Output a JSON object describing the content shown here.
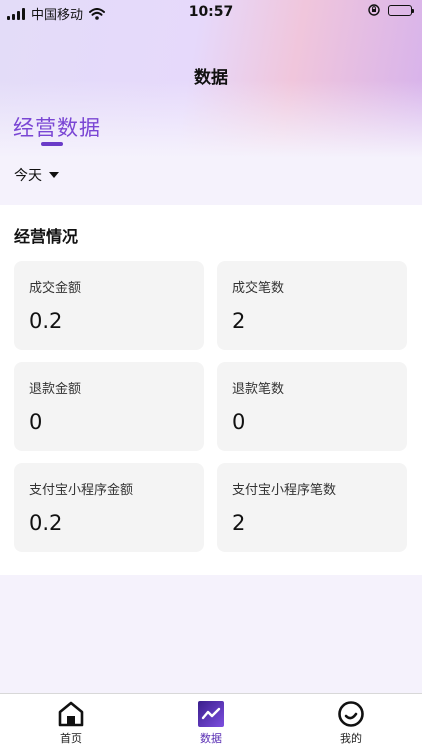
{
  "status_bar": {
    "carrier": "中国移动",
    "time": "10:57"
  },
  "header": {
    "title": "数据"
  },
  "section_tab": {
    "label": "经营数据"
  },
  "date_filter": {
    "label": "今天"
  },
  "overview": {
    "title": "经营情况",
    "cards": [
      {
        "label": "成交金额",
        "value": "0.2"
      },
      {
        "label": "成交笔数",
        "value": "2"
      },
      {
        "label": "退款金额",
        "value": "0"
      },
      {
        "label": "退款笔数",
        "value": "0"
      },
      {
        "label": "支付宝小程序金额",
        "value": "0.2"
      },
      {
        "label": "支付宝小程序笔数",
        "value": "2"
      }
    ]
  },
  "tabbar": {
    "items": [
      {
        "label": "首页",
        "icon": "home-icon"
      },
      {
        "label": "数据",
        "icon": "chart-icon"
      },
      {
        "label": "我的",
        "icon": "profile-icon"
      }
    ]
  },
  "colors": {
    "accent": "#6a3bc8",
    "tab_text": "#7a46d4"
  }
}
